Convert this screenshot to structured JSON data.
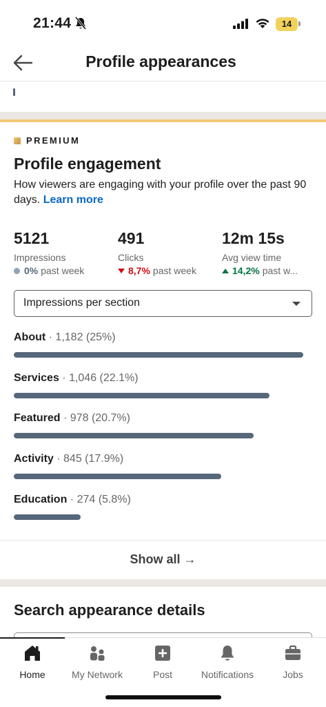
{
  "status_bar": {
    "time": "21:44",
    "battery_level": "14",
    "icons": [
      "bell-off-icon",
      "cellular-signal-icon",
      "wifi-icon",
      "battery-icon"
    ]
  },
  "header": {
    "title": "Profile appearances",
    "back_icon": "back-arrow-icon"
  },
  "premium": {
    "badge": "PREMIUM",
    "title": "Profile engagement",
    "description": "How viewers are engaging with your profile over the past 90 days.",
    "learn_more": "Learn more"
  },
  "metrics": [
    {
      "value": "5121",
      "label": "Impressions",
      "change": "0%",
      "change_suffix": "past week",
      "trend": "neutral"
    },
    {
      "value": "491",
      "label": "Clicks",
      "change": "8,7%",
      "change_suffix": "past week",
      "trend": "down"
    },
    {
      "value": "12m 15s",
      "label": "Avg view time",
      "change": "14,2%",
      "change_suffix": "past w...",
      "trend": "up"
    }
  ],
  "dropdown": {
    "selected": "Impressions per section"
  },
  "sections": [
    {
      "name": "About",
      "detail": " · 1,182 (25%)",
      "share": 25
    },
    {
      "name": "Services",
      "detail": " · 1,046 (22.1%)",
      "share": 22.1
    },
    {
      "name": "Featured",
      "detail": " · 978 (20.7%)",
      "share": 20.7
    },
    {
      "name": "Activity",
      "detail": " · 845 (17.9%)",
      "share": 17.9
    },
    {
      "name": "Education",
      "detail": " · 274 (5.8%)",
      "share": 5.8
    }
  ],
  "show_all": "Show all →",
  "search_section_title": "Search appearance details",
  "bottom_nav": [
    {
      "label": "Home",
      "icon": "home-icon",
      "active": true
    },
    {
      "label": "My Network",
      "icon": "network-icon",
      "active": false
    },
    {
      "label": "Post",
      "icon": "post-icon",
      "active": false
    },
    {
      "label": "Notifications",
      "icon": "bell-icon",
      "active": false
    },
    {
      "label": "Jobs",
      "icon": "briefcase-icon",
      "active": false
    }
  ],
  "colors": {
    "accent_link": "#0a66c2",
    "bar": "#56687a",
    "negative": "#cc1016",
    "positive": "#057642",
    "premium_gold": "#f3c774"
  }
}
